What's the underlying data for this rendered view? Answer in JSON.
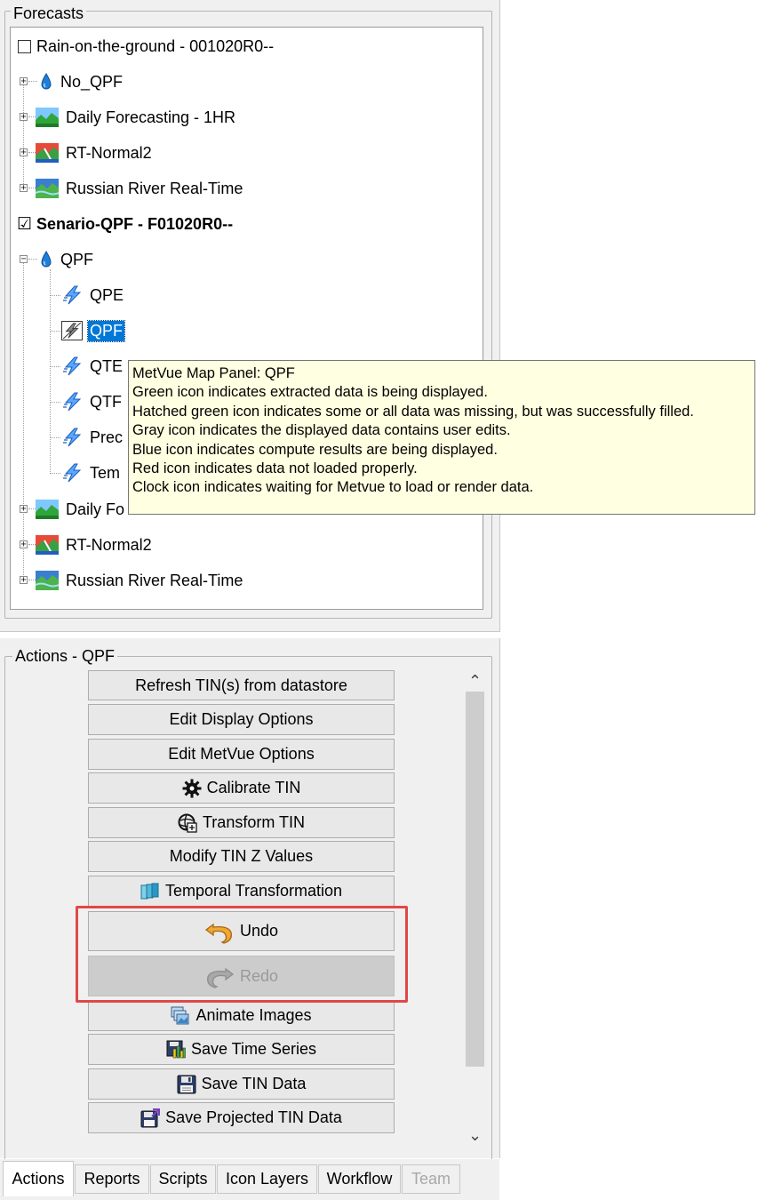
{
  "forecasts": {
    "group_title": "Forecasts",
    "items": [
      {
        "label": "Rain-on-the-ground - 001020R0--",
        "checked": false
      },
      {
        "label": "No_QPF"
      },
      {
        "label": "Daily Forecasting - 1HR"
      },
      {
        "label": "RT-Normal2"
      },
      {
        "label": "Russian River Real-Time"
      },
      {
        "label": "Senario-QPF - F01020R0--",
        "checked": true
      },
      {
        "label": "QPF"
      },
      {
        "label": "QPE"
      },
      {
        "label": "QPF",
        "selected": true
      },
      {
        "label": "QTE"
      },
      {
        "label": "QTF"
      },
      {
        "label": "Prec"
      },
      {
        "label": "Tem"
      },
      {
        "label": "Daily Fo"
      },
      {
        "label": "RT-Normal2"
      },
      {
        "label": "Russian River Real-Time"
      }
    ],
    "check_mark": "☑"
  },
  "tooltip": {
    "lines": [
      "MetVue Map Panel: QPF",
      "Green icon indicates extracted data is being displayed.",
      "Hatched green icon indicates some or all data was missing, but was successfully filled.",
      "Gray icon indicates the displayed data contains user edits.",
      "Blue icon indicates compute results are being displayed.",
      "Red icon indicates data not loaded properly.",
      "Clock icon indicates waiting for Metvue to load or render data."
    ]
  },
  "actions": {
    "group_title": "Actions - QPF",
    "buttons": [
      {
        "label": "Refresh TIN(s) from datastore",
        "icon": ""
      },
      {
        "label": "Edit Display Options",
        "icon": ""
      },
      {
        "label": "Edit MetVue Options",
        "icon": ""
      },
      {
        "label": "Calibrate TIN",
        "icon": "gear-icon"
      },
      {
        "label": "Transform TIN",
        "icon": "globe-transform-icon"
      },
      {
        "label": "Modify TIN Z Values",
        "icon": ""
      },
      {
        "label": "Temporal Transformation",
        "icon": "layers-icon"
      },
      {
        "label": "Undo",
        "icon": "undo-icon"
      },
      {
        "label": "Redo",
        "icon": "redo-icon",
        "disabled": true
      },
      {
        "label": "Animate Images",
        "icon": "images-icon"
      },
      {
        "label": "Save Time Series",
        "icon": "save-chart-icon"
      },
      {
        "label": "Save TIN Data",
        "icon": "floppy-icon"
      },
      {
        "label": "Save Projected TIN Data",
        "icon": "floppy-export-icon"
      }
    ],
    "scroll_up": "⌃",
    "scroll_down": "⌄"
  },
  "tabs": [
    {
      "label": "Actions",
      "active": true
    },
    {
      "label": "Reports"
    },
    {
      "label": "Scripts"
    },
    {
      "label": "Icon Layers"
    },
    {
      "label": "Workflow"
    },
    {
      "label": "Team",
      "disabled": true
    }
  ],
  "colors": {
    "selection": "#0078d7",
    "tooltip_bg": "#ffffe1",
    "highlight": "#e04848"
  }
}
